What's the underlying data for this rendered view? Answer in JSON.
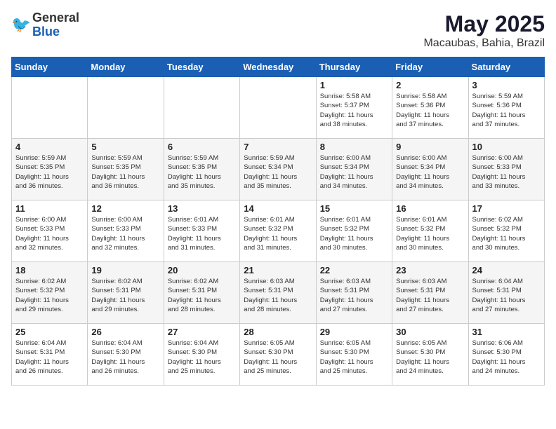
{
  "header": {
    "logo_general": "General",
    "logo_blue": "Blue",
    "title": "May 2025",
    "location": "Macaubas, Bahia, Brazil"
  },
  "weekdays": [
    "Sunday",
    "Monday",
    "Tuesday",
    "Wednesday",
    "Thursday",
    "Friday",
    "Saturday"
  ],
  "weeks": [
    [
      {
        "day": "",
        "info": ""
      },
      {
        "day": "",
        "info": ""
      },
      {
        "day": "",
        "info": ""
      },
      {
        "day": "",
        "info": ""
      },
      {
        "day": "1",
        "info": "Sunrise: 5:58 AM\nSunset: 5:37 PM\nDaylight: 11 hours\nand 38 minutes."
      },
      {
        "day": "2",
        "info": "Sunrise: 5:58 AM\nSunset: 5:36 PM\nDaylight: 11 hours\nand 37 minutes."
      },
      {
        "day": "3",
        "info": "Sunrise: 5:59 AM\nSunset: 5:36 PM\nDaylight: 11 hours\nand 37 minutes."
      }
    ],
    [
      {
        "day": "4",
        "info": "Sunrise: 5:59 AM\nSunset: 5:35 PM\nDaylight: 11 hours\nand 36 minutes."
      },
      {
        "day": "5",
        "info": "Sunrise: 5:59 AM\nSunset: 5:35 PM\nDaylight: 11 hours\nand 36 minutes."
      },
      {
        "day": "6",
        "info": "Sunrise: 5:59 AM\nSunset: 5:35 PM\nDaylight: 11 hours\nand 35 minutes."
      },
      {
        "day": "7",
        "info": "Sunrise: 5:59 AM\nSunset: 5:34 PM\nDaylight: 11 hours\nand 35 minutes."
      },
      {
        "day": "8",
        "info": "Sunrise: 6:00 AM\nSunset: 5:34 PM\nDaylight: 11 hours\nand 34 minutes."
      },
      {
        "day": "9",
        "info": "Sunrise: 6:00 AM\nSunset: 5:34 PM\nDaylight: 11 hours\nand 34 minutes."
      },
      {
        "day": "10",
        "info": "Sunrise: 6:00 AM\nSunset: 5:33 PM\nDaylight: 11 hours\nand 33 minutes."
      }
    ],
    [
      {
        "day": "11",
        "info": "Sunrise: 6:00 AM\nSunset: 5:33 PM\nDaylight: 11 hours\nand 32 minutes."
      },
      {
        "day": "12",
        "info": "Sunrise: 6:00 AM\nSunset: 5:33 PM\nDaylight: 11 hours\nand 32 minutes."
      },
      {
        "day": "13",
        "info": "Sunrise: 6:01 AM\nSunset: 5:33 PM\nDaylight: 11 hours\nand 31 minutes."
      },
      {
        "day": "14",
        "info": "Sunrise: 6:01 AM\nSunset: 5:32 PM\nDaylight: 11 hours\nand 31 minutes."
      },
      {
        "day": "15",
        "info": "Sunrise: 6:01 AM\nSunset: 5:32 PM\nDaylight: 11 hours\nand 30 minutes."
      },
      {
        "day": "16",
        "info": "Sunrise: 6:01 AM\nSunset: 5:32 PM\nDaylight: 11 hours\nand 30 minutes."
      },
      {
        "day": "17",
        "info": "Sunrise: 6:02 AM\nSunset: 5:32 PM\nDaylight: 11 hours\nand 30 minutes."
      }
    ],
    [
      {
        "day": "18",
        "info": "Sunrise: 6:02 AM\nSunset: 5:32 PM\nDaylight: 11 hours\nand 29 minutes."
      },
      {
        "day": "19",
        "info": "Sunrise: 6:02 AM\nSunset: 5:31 PM\nDaylight: 11 hours\nand 29 minutes."
      },
      {
        "day": "20",
        "info": "Sunrise: 6:02 AM\nSunset: 5:31 PM\nDaylight: 11 hours\nand 28 minutes."
      },
      {
        "day": "21",
        "info": "Sunrise: 6:03 AM\nSunset: 5:31 PM\nDaylight: 11 hours\nand 28 minutes."
      },
      {
        "day": "22",
        "info": "Sunrise: 6:03 AM\nSunset: 5:31 PM\nDaylight: 11 hours\nand 27 minutes."
      },
      {
        "day": "23",
        "info": "Sunrise: 6:03 AM\nSunset: 5:31 PM\nDaylight: 11 hours\nand 27 minutes."
      },
      {
        "day": "24",
        "info": "Sunrise: 6:04 AM\nSunset: 5:31 PM\nDaylight: 11 hours\nand 27 minutes."
      }
    ],
    [
      {
        "day": "25",
        "info": "Sunrise: 6:04 AM\nSunset: 5:31 PM\nDaylight: 11 hours\nand 26 minutes."
      },
      {
        "day": "26",
        "info": "Sunrise: 6:04 AM\nSunset: 5:30 PM\nDaylight: 11 hours\nand 26 minutes."
      },
      {
        "day": "27",
        "info": "Sunrise: 6:04 AM\nSunset: 5:30 PM\nDaylight: 11 hours\nand 25 minutes."
      },
      {
        "day": "28",
        "info": "Sunrise: 6:05 AM\nSunset: 5:30 PM\nDaylight: 11 hours\nand 25 minutes."
      },
      {
        "day": "29",
        "info": "Sunrise: 6:05 AM\nSunset: 5:30 PM\nDaylight: 11 hours\nand 25 minutes."
      },
      {
        "day": "30",
        "info": "Sunrise: 6:05 AM\nSunset: 5:30 PM\nDaylight: 11 hours\nand 24 minutes."
      },
      {
        "day": "31",
        "info": "Sunrise: 6:06 AM\nSunset: 5:30 PM\nDaylight: 11 hours\nand 24 minutes."
      }
    ]
  ]
}
